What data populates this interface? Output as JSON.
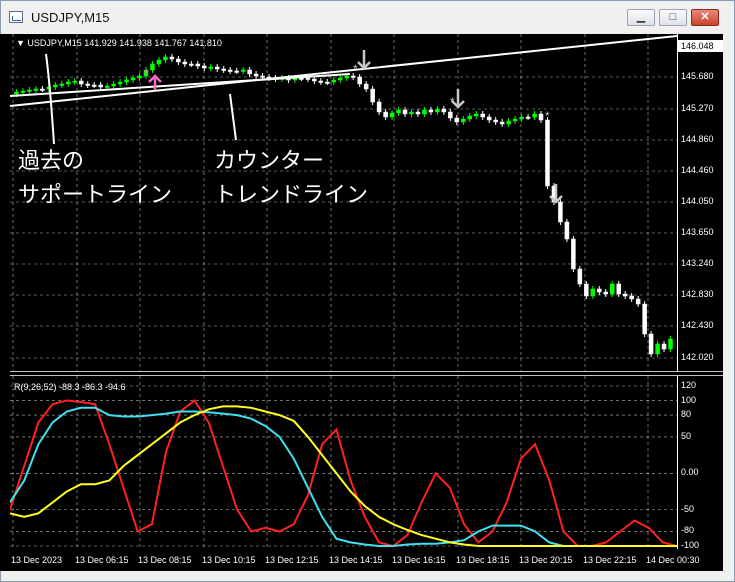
{
  "window": {
    "title": "USDJPY,M15"
  },
  "chart": {
    "header": "▼ USDJPY,M15  141.929 141.938 141.767 141.810",
    "current_price": "146.048",
    "price_ticks": [
      "145.680",
      "145.270",
      "144.860",
      "144.460",
      "144.050",
      "143.650",
      "143.240",
      "142.830",
      "142.430",
      "142.020"
    ],
    "annotations": {
      "left_line1": "過去の",
      "left_line2": "サポートライン",
      "right_line1": "カウンター",
      "right_line2": "トレンドライン"
    },
    "colors": {
      "background": "#000000",
      "bull": "#00ff00",
      "bear": "#ffffff",
      "trendline": "#ffffff",
      "arrow_up": "#ff66cc",
      "arrow_down": "#c8c8c8",
      "grid": "#ffffff"
    }
  },
  "indicator": {
    "label": "R(9,26,52) -88.3 -86.3 -94.6",
    "ticks": [
      "120",
      "100",
      "80",
      "50",
      "0.00",
      "-50",
      "-80",
      "-100"
    ],
    "series": [
      {
        "color": "#ff2020",
        "values": [
          -50,
          10,
          70,
          95,
          100,
          98,
          95,
          40,
          -20,
          -80,
          -70,
          30,
          85,
          100,
          70,
          10,
          -50,
          -80,
          -75,
          -80,
          -70,
          -30,
          40,
          60,
          -10,
          -60,
          -95,
          -100,
          -85,
          -40,
          0,
          -20,
          -70,
          -95,
          -80,
          -40,
          20,
          40,
          -10,
          -80,
          -100,
          -100,
          -95,
          -80,
          -65,
          -75,
          -95,
          -100
        ]
      },
      {
        "color": "#40e0f0",
        "values": [
          -40,
          -10,
          40,
          70,
          85,
          90,
          90,
          80,
          78,
          78,
          80,
          82,
          85,
          85,
          84,
          82,
          80,
          75,
          65,
          50,
          20,
          -20,
          -60,
          -90,
          -95,
          -98,
          -100,
          -100,
          -98,
          -97,
          -97,
          -95,
          -92,
          -80,
          -72,
          -72,
          -72,
          -80,
          -95,
          -100,
          -100,
          -100,
          -100,
          -100,
          -100,
          -100,
          -100,
          -100
        ]
      },
      {
        "color": "#ffff20",
        "values": [
          -55,
          -60,
          -55,
          -40,
          -25,
          -15,
          -15,
          -10,
          10,
          25,
          40,
          55,
          70,
          80,
          88,
          92,
          92,
          90,
          85,
          80,
          72,
          50,
          25,
          0,
          -25,
          -45,
          -60,
          -70,
          -78,
          -85,
          -90,
          -95,
          -98,
          -100,
          -100,
          -100,
          -100,
          -100,
          -100,
          -100,
          -100,
          -100,
          -100,
          -100,
          -100,
          -100,
          -100,
          -100
        ]
      }
    ]
  },
  "xaxis": {
    "labels": [
      "13 Dec 2023",
      "13 Dec 06:15",
      "13 Dec 08:15",
      "13 Dec 10:15",
      "13 Dec 12:15",
      "13 Dec 14:15",
      "13 Dec 16:15",
      "13 Dec 18:15",
      "13 Dec 20:15",
      "13 Dec 22:15",
      "14 Dec 00:30"
    ]
  }
}
